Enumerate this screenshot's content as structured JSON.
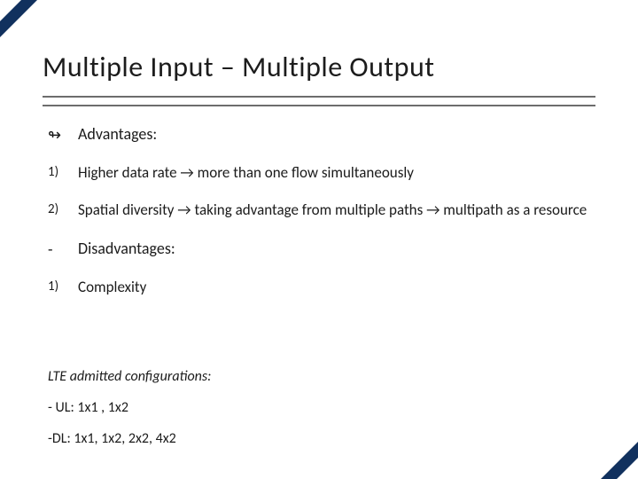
{
  "title": "Multiple Input – Multiple Output",
  "bullets": [
    {
      "marker": "↬",
      "text": "Advantages:"
    },
    {
      "marker": "1)",
      "text": "Higher data rate → more than one flow simultaneously"
    },
    {
      "marker": "2)",
      "text": "Spatial diversity → taking advantage from multiple paths → multipath as a resource"
    },
    {
      "marker": "-",
      "text": "Disadvantages:"
    },
    {
      "marker": "1)",
      "text": "Complexity"
    }
  ],
  "footer": {
    "line1": "LTE admitted configurations:",
    "line2": "- UL: 1x1 , 1x2",
    "line3": "-DL: 1x1, 1x2, 2x2, 4x2"
  }
}
